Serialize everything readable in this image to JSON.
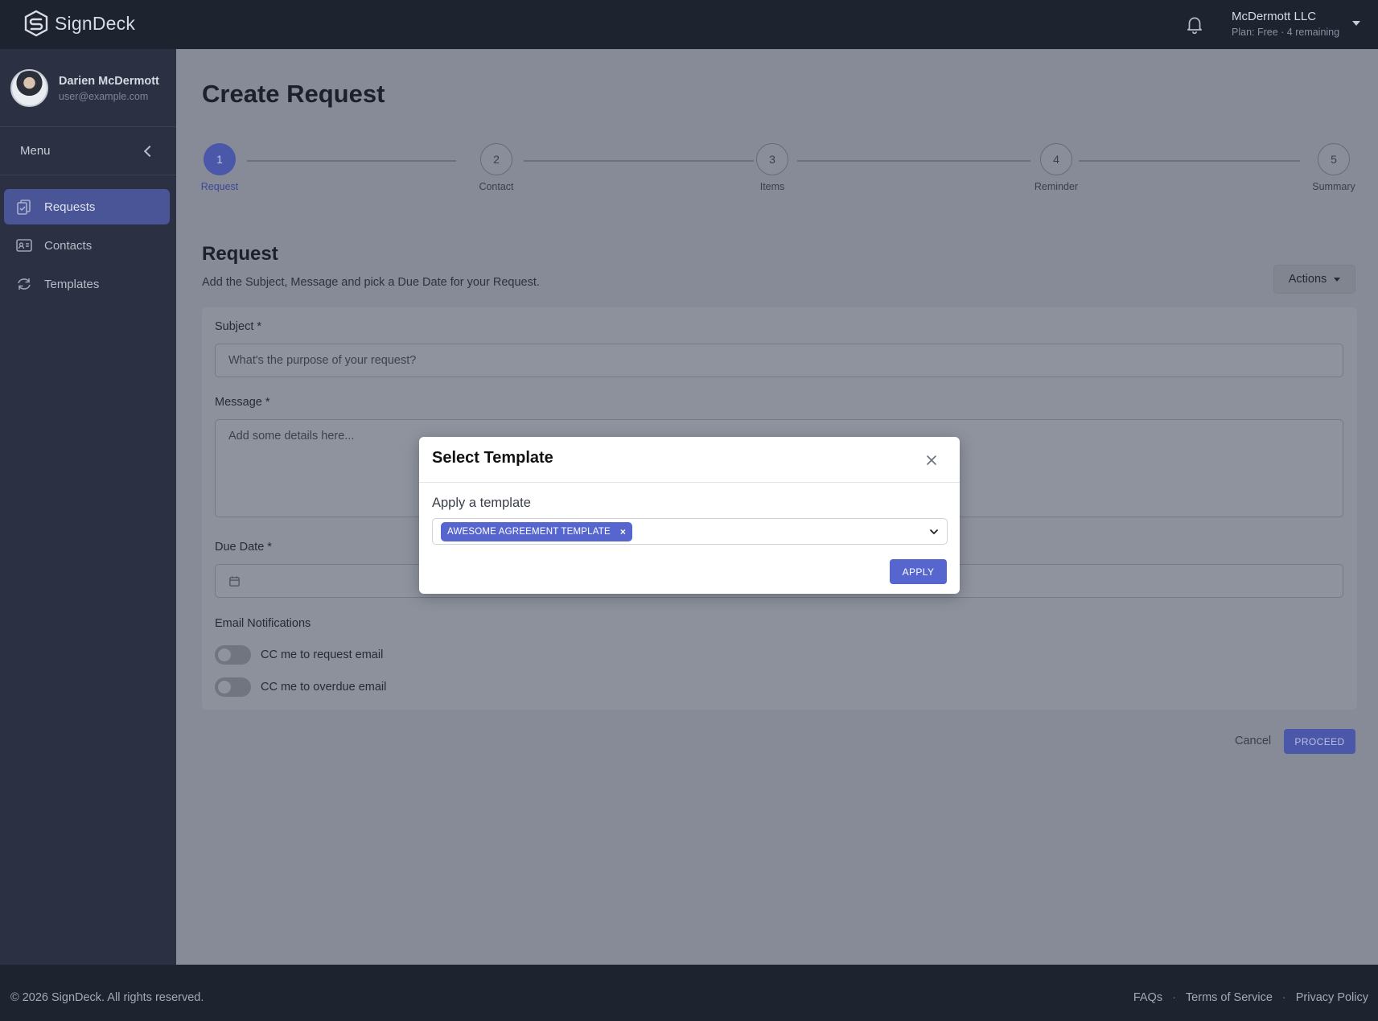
{
  "app": {
    "name": "SignDeck"
  },
  "account": {
    "org": "McDermott LLC",
    "plan": "Plan: Free · 4 remaining"
  },
  "user": {
    "name": "Darien McDermott",
    "email": "user@example.com"
  },
  "sidebar": {
    "menu_label": "Menu",
    "items": [
      {
        "label": "Requests",
        "icon": "requests-icon",
        "active": true
      },
      {
        "label": "Contacts",
        "icon": "contacts-icon",
        "active": false
      },
      {
        "label": "Templates",
        "icon": "templates-icon",
        "active": false
      }
    ]
  },
  "page": {
    "title": "Create Request"
  },
  "stepper": {
    "current": 1,
    "steps": [
      {
        "number": "1",
        "label": "Request"
      },
      {
        "number": "2",
        "label": "Contact"
      },
      {
        "number": "3",
        "label": "Items"
      },
      {
        "number": "4",
        "label": "Reminder"
      },
      {
        "number": "5",
        "label": "Summary"
      }
    ]
  },
  "section": {
    "title": "Request",
    "subtitle": "Add the Subject, Message and pick a Due Date for your Request.",
    "actions_label": "Actions"
  },
  "form": {
    "subject_label": "Subject *",
    "subject_placeholder": "What's the purpose of your request?",
    "message_label": "Message *",
    "message_placeholder": "Add some details here...",
    "due_date_label": "Due Date *",
    "due_date_value": "",
    "notifications_label": "Email Notifications",
    "toggles": [
      {
        "label": "CC me to request email",
        "on": false
      },
      {
        "label": "CC me to overdue email",
        "on": false
      }
    ]
  },
  "buttons": {
    "cancel": "Cancel",
    "proceed": "PROCEED"
  },
  "modal": {
    "title": "Select Template",
    "label": "Apply a template",
    "selected_template": "AWESOME AGREEMENT TEMPLATE",
    "remove_glyph": "×",
    "apply": "APPLY"
  },
  "footer": {
    "copyright": "© 2026 SignDeck. All rights reserved.",
    "links": [
      "FAQs",
      "Terms of Service",
      "Privacy Policy"
    ],
    "separator": "·"
  },
  "colors": {
    "accent": "#5766cf",
    "accent_dim": "#4b57a8",
    "chrome": "#1e2330",
    "sidebar": "#2b3142",
    "overlay_main": "#868b97"
  }
}
